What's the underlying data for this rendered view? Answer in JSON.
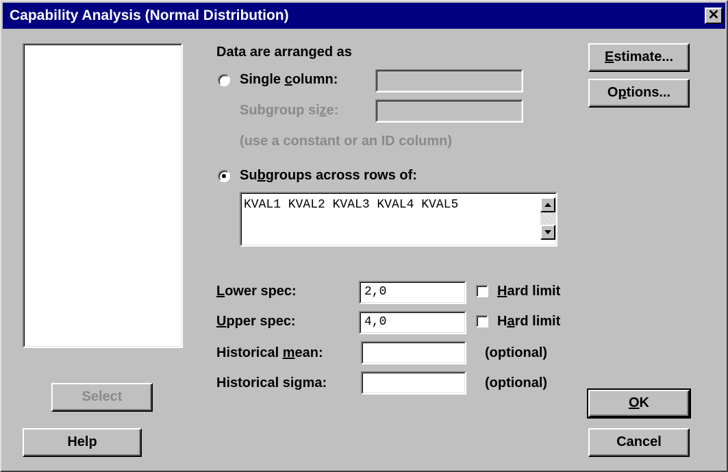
{
  "window": {
    "title": "Capability Analysis (Normal Distribution)",
    "close_glyph": "✕"
  },
  "arrangement": {
    "heading": "Data are arranged as",
    "single_column": {
      "label_pre": "Single ",
      "label_mnemonic": "c",
      "label_post": "olumn:",
      "selected": false,
      "value": ""
    },
    "subgroup_size": {
      "label_pre": "Subgroup si",
      "label_mnemonic": "z",
      "label_post": "e:",
      "value": ""
    },
    "hint": "(use a constant or an ID column)",
    "subgroups_across_rows": {
      "label_pre": "Su",
      "label_mnemonic": "b",
      "label_post": "groups across rows of:",
      "selected": true,
      "value": "KVAL1 KVAL2 KVAL3 KVAL4 KVAL5"
    }
  },
  "specs": {
    "lower": {
      "label_mnemonic": "L",
      "label_post": "ower spec:",
      "value": "2,0",
      "hard_limit_pre": "",
      "hard_limit_mnemonic": "H",
      "hard_limit_post": "ard limit",
      "hard_limit_checked": false
    },
    "upper": {
      "label_mnemonic": "U",
      "label_post": "pper spec:",
      "value": "4,0",
      "hard_limit_pre": "H",
      "hard_limit_mnemonic": "a",
      "hard_limit_post": "rd limit",
      "hard_limit_checked": false
    },
    "historical_mean": {
      "label_pre": "Historical ",
      "label_mnemonic": "m",
      "label_post": "ean:",
      "value": "",
      "optional": "(optional)"
    },
    "historical_sigma": {
      "label": "Historical sigma:",
      "value": "",
      "optional": "(optional)"
    }
  },
  "buttons": {
    "estimate": {
      "mnemonic": "E",
      "rest": "stimate..."
    },
    "options": {
      "pre": "O",
      "mnemonic": "p",
      "rest": "tions..."
    },
    "select": "Select",
    "help": "Help",
    "ok": {
      "mnemonic": "O",
      "rest": "K"
    },
    "cancel": "Cancel"
  }
}
